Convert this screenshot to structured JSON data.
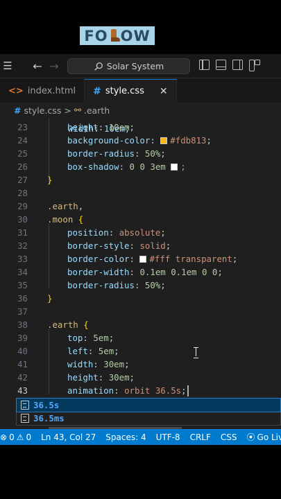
{
  "banner": {
    "text_left": "FO",
    "text_right": "OW"
  },
  "titlebar": {
    "search_text": "Solar System"
  },
  "tabs": [
    {
      "label": "index.html",
      "icon": "<>"
    },
    {
      "label": "style.css",
      "icon": "#",
      "close": "✕"
    }
  ],
  "breadcrumb": {
    "file": "style.css",
    "sep": ">",
    "selector": ".earth"
  },
  "code": {
    "partial": "    width: 10em;",
    "lines": [
      {
        "n": "23"
      },
      {
        "n": "24"
      },
      {
        "n": "25"
      },
      {
        "n": "26"
      },
      {
        "n": "27"
      },
      {
        "n": "28"
      },
      {
        "n": "29"
      },
      {
        "n": "30"
      },
      {
        "n": "31"
      },
      {
        "n": "32"
      },
      {
        "n": "33"
      },
      {
        "n": "34"
      },
      {
        "n": "35"
      },
      {
        "n": "36"
      },
      {
        "n": "37"
      },
      {
        "n": "38"
      },
      {
        "n": "39"
      },
      {
        "n": "40"
      },
      {
        "n": "41"
      },
      {
        "n": "42"
      },
      {
        "n": "43"
      }
    ],
    "colors": {
      "swatch_sun": "#fdb813",
      "swatch_white": "#ffffff"
    }
  },
  "tokens": {
    "l23": [
      "height",
      ":",
      " 10em",
      ";"
    ],
    "l24": [
      "background-color",
      ":",
      "#fdb813",
      ";"
    ],
    "l25": [
      "border-radius",
      ":",
      " 50%",
      ";"
    ],
    "l26": [
      "box-shadow",
      ":",
      " 0 0 3em ",
      "#fff",
      ";"
    ],
    "l27": [
      "}"
    ],
    "l29": [
      ".earth",
      ","
    ],
    "l30": [
      ".moon",
      " {"
    ],
    "l31": [
      "position",
      ":",
      " absolute",
      ";"
    ],
    "l32": [
      "border-style",
      ":",
      " solid",
      ";"
    ],
    "l33": [
      "border-color",
      ":",
      "#fff transparent",
      ";"
    ],
    "l34": [
      "border-width",
      ":",
      " 0.1em 0.1em 0 0",
      ";"
    ],
    "l35": [
      "border-radius",
      ":",
      " 50%",
      ";"
    ],
    "l36": [
      "}"
    ],
    "l38": [
      ".earth",
      " {"
    ],
    "l39": [
      "top",
      ":",
      " 5em",
      ";"
    ],
    "l40": [
      "left",
      ":",
      " 5em",
      ";"
    ],
    "l41": [
      "width",
      ":",
      " 30em",
      ";"
    ],
    "l42": [
      "height",
      ":",
      " 30em",
      ";"
    ],
    "l43": [
      "animation",
      ":",
      " orbit 36.5s",
      ";"
    ]
  },
  "suggestions": [
    {
      "label": "36.5s"
    },
    {
      "label": "36.5ms"
    }
  ],
  "statusbar": {
    "errors": "0",
    "warnings": "0",
    "position": "Ln 43, Col 27",
    "spaces": "Spaces: 4",
    "encoding": "UTF-8",
    "eol": "CRLF",
    "language": "CSS",
    "live": "Go Live"
  }
}
